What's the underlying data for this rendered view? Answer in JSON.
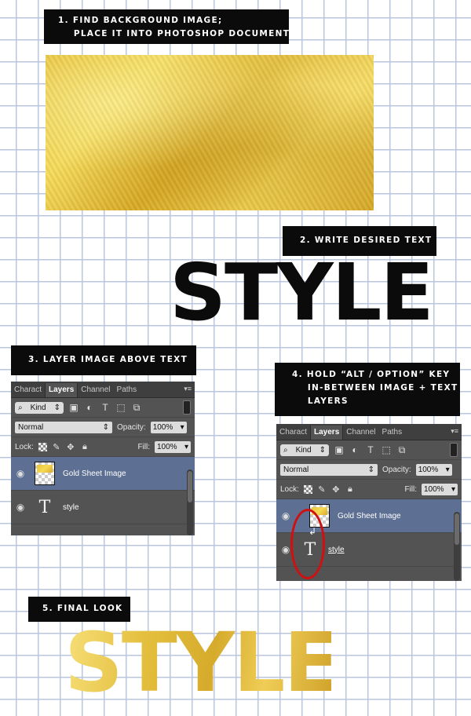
{
  "steps": {
    "step1": "1. FIND BACKGROUND IMAGE;\n    PLACE IT INTO PHOTOSHOP DOCUMENT",
    "step2": "2. WRITE DESIRED TEXT",
    "step3": "3. LAYER IMAGE ABOVE TEXT",
    "step4": "4. HOLD “ALT / OPTION” KEY\n    IN-BETWEEN IMAGE + TEXT\n    LAYERS",
    "step5": "5. FINAL LOOK"
  },
  "display": {
    "style_black": "STYLE",
    "style_gold": "STYLE"
  },
  "panel": {
    "tabs": [
      "Charact",
      "Layers",
      "Channel",
      "Paths"
    ],
    "active_tab": "Layers",
    "filter_kind": "Kind",
    "blend_mode": "Normal",
    "opacity_label": "Opacity:",
    "opacity_value": "100%",
    "lock_label": "Lock:",
    "fill_label": "Fill:",
    "fill_value": "100%",
    "layers": [
      {
        "name": "Gold Sheet Image",
        "type": "image",
        "selected": true
      },
      {
        "name": "style",
        "type": "text",
        "selected": false
      }
    ]
  },
  "colors": {
    "label_bg": "#0b0b0b",
    "grid": "#b9c6dd",
    "gold": "#e4bf40",
    "panel_bg": "#535353",
    "selected_layer": "#5d6f92",
    "highlight_circle": "#d01010"
  },
  "icons": [
    "eye-icon",
    "text-layer-icon",
    "clipping-arrow-icon",
    "search-icon",
    "lock-icon",
    "brush-icon",
    "move-icon",
    "menu-icon"
  ]
}
